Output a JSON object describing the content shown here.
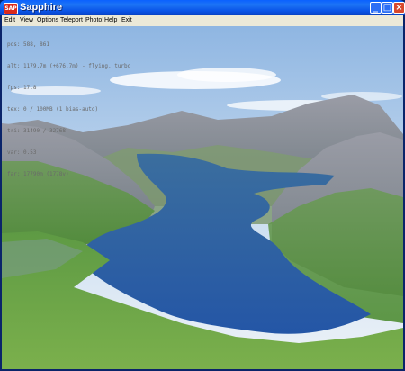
{
  "window": {
    "title": "Sapphire",
    "app_icon_label": "SAP",
    "controls": {
      "minimize": "_",
      "maximize": "□",
      "close": "×"
    }
  },
  "menu": [
    {
      "label": "Edit"
    },
    {
      "label": "View"
    },
    {
      "label": "Options"
    },
    {
      "label": "Teleport"
    },
    {
      "label": "Photo!"
    },
    {
      "label": "Help"
    },
    {
      "label": "Exit"
    }
  ],
  "hud": {
    "pos": "pos: 588, 861",
    "alt": "alt: 1179.7m (+676.7m) - flying, turbo",
    "fps": "fps: 17.8",
    "tex": "tex: 0 / 100MB (1 bias-auto)",
    "tri": "tri: 31490 / 32768",
    "var": "var: 0.53",
    "far": "far: 17790m (1778v)"
  },
  "scene": {
    "sky_top": "#9ec1e8",
    "sky_horizon": "#e4eef8",
    "water": "#2a5fa8",
    "grass": "#5b9a3e",
    "rock": "#8c8f98"
  }
}
